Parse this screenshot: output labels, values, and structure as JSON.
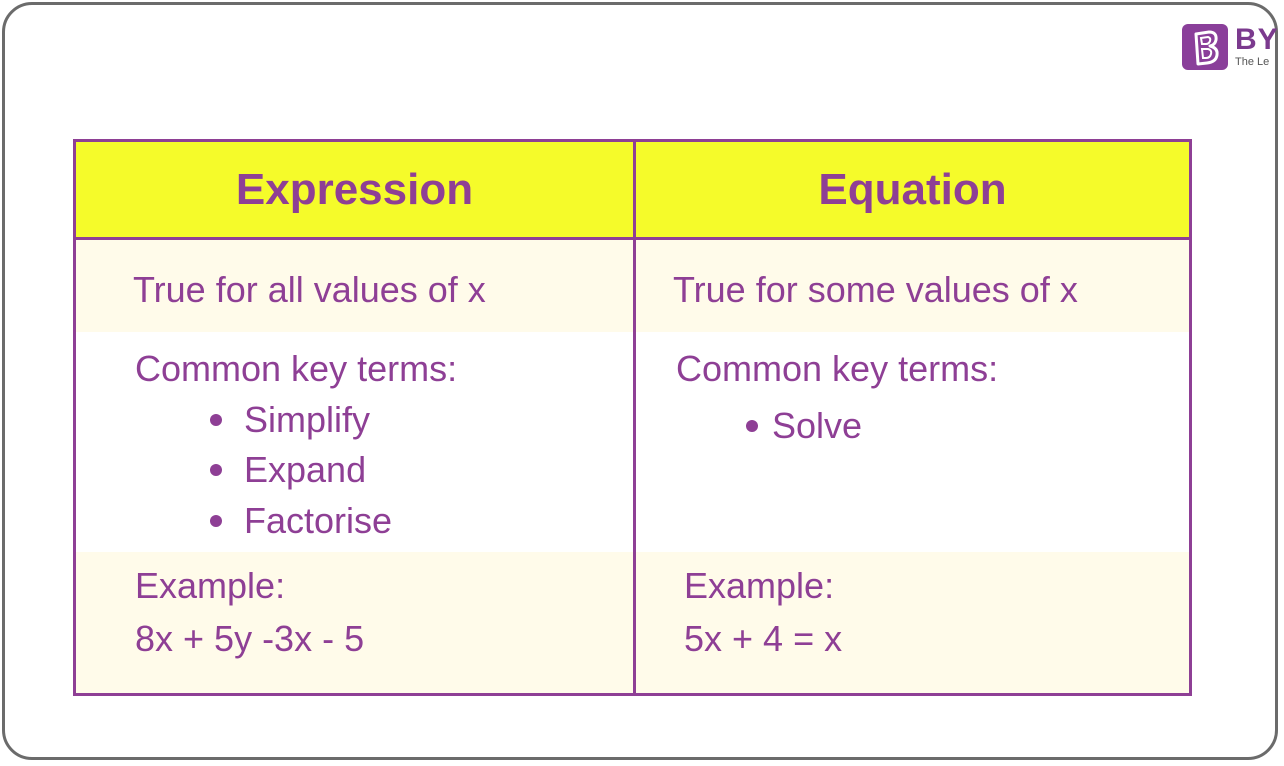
{
  "logo": {
    "brand": "BY",
    "tagline": "The Le",
    "icon": "byjus-b-logo-icon",
    "color": "#8a3f9a"
  },
  "colors": {
    "accent": "#8e3f95",
    "header_bg": "#f5fb2a",
    "row_tint": "#fffbea",
    "frame": "#6b6b6b"
  },
  "table": {
    "headers": [
      "Expression",
      "Equation"
    ],
    "rows": {
      "truth": [
        "True for all values of x",
        "True for some values of x"
      ],
      "key_terms_label": [
        "Common key terms:",
        "Common key terms:"
      ],
      "expression_terms": [
        "Simplify",
        "Expand",
        "Factorise"
      ],
      "equation_terms": [
        "Solve"
      ],
      "example_label": [
        "Example:",
        "Example:"
      ],
      "example_value": [
        "8x + 5y -3x - 5",
        "5x + 4 = x"
      ]
    }
  }
}
